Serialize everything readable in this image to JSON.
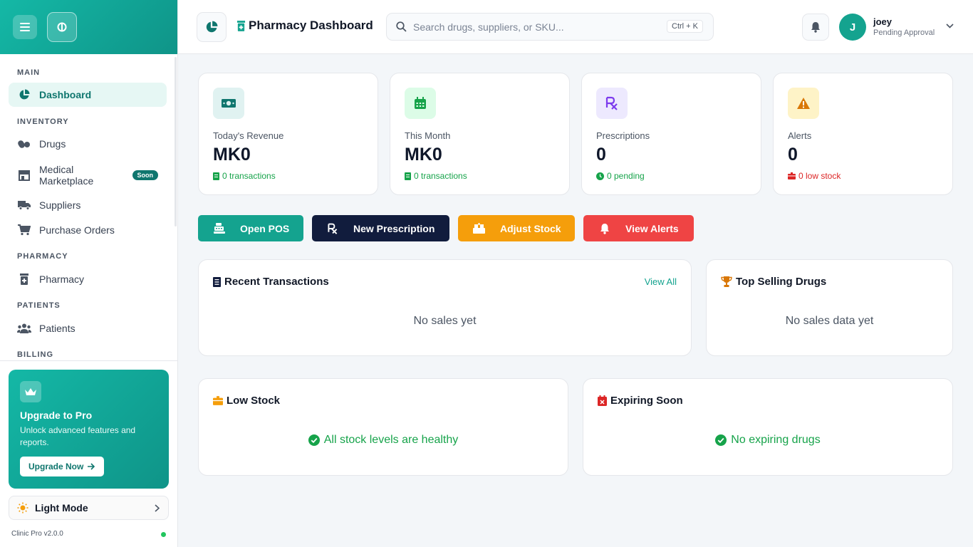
{
  "sidebar": {
    "sections": {
      "main": "MAIN",
      "inventory": "INVENTORY",
      "pharmacy": "PHARMACY",
      "patients": "PATIENTS",
      "billing": "BILLING"
    },
    "items": {
      "dashboard": "Dashboard",
      "drugs": "Drugs",
      "marketplace_line1": "Medical",
      "marketplace_line2": "Marketplace",
      "marketplace_badge": "Soon",
      "suppliers": "Suppliers",
      "purchase_orders": "Purchase Orders",
      "pharmacy": "Pharmacy",
      "patients": "Patients"
    },
    "promo": {
      "title": "Upgrade to Pro",
      "description": "Unlock advanced features and reports.",
      "button": "Upgrade Now"
    },
    "theme_toggle": "Light Mode",
    "version": "Clinic Pro v2.0.0"
  },
  "header": {
    "title": "Pharmacy Dashboard",
    "search_placeholder": "Search drugs, suppliers, or SKU...",
    "shortcut": "Ctrl + K",
    "user": {
      "initial": "J",
      "name": "joey",
      "status": "Pending Approval"
    }
  },
  "stats": [
    {
      "label": "Today's Revenue",
      "value": "MK0",
      "sub": "0 transactions",
      "icon": "money-icon",
      "color": "#16a34a",
      "bg": "#e0f2f1"
    },
    {
      "label": "This Month",
      "value": "MK0",
      "sub": "0 transactions",
      "icon": "calendar-icon",
      "color": "#16a34a",
      "bg": "#dcfce7"
    },
    {
      "label": "Prescriptions",
      "value": "0",
      "sub": "0 pending",
      "icon": "rx-icon",
      "color": "#16a34a",
      "bg": "#ede9fe"
    },
    {
      "label": "Alerts",
      "value": "0",
      "sub": "0 low stock",
      "icon": "warning-icon",
      "color": "#dc2626",
      "bg": "#fef3c7"
    }
  ],
  "actions": {
    "open_pos": "Open POS",
    "new_prescription": "New Prescription",
    "adjust_stock": "Adjust Stock",
    "view_alerts": "View Alerts"
  },
  "panels": {
    "recent_transactions": {
      "title": "Recent Transactions",
      "link": "View All",
      "empty": "No sales yet"
    },
    "top_selling": {
      "title": "Top Selling Drugs",
      "empty": "No sales data yet"
    },
    "low_stock": {
      "title": "Low Stock",
      "empty": "All stock levels are healthy"
    },
    "expiring": {
      "title": "Expiring Soon",
      "empty": "No expiring drugs"
    }
  },
  "colors": {
    "brand": "#14a38f",
    "navy": "#111c3d",
    "orange": "#f59e0b",
    "red": "#ef4444"
  }
}
